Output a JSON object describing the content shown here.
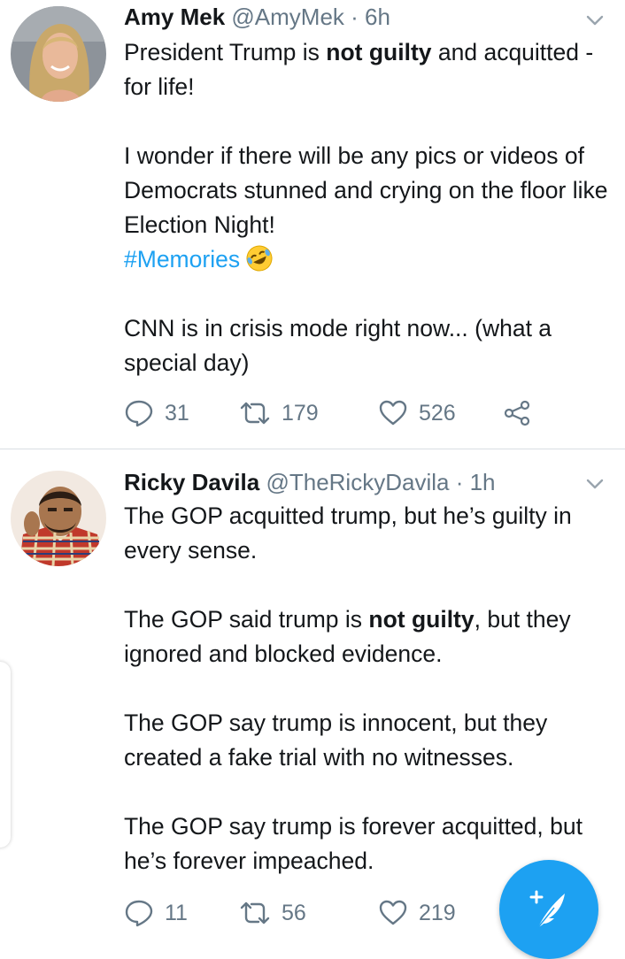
{
  "tweets": [
    {
      "name": "Amy Mek",
      "handle": "@AmyMek",
      "dot": "·",
      "time": "6h",
      "text": {
        "p1_a": "President Trump is ",
        "p1_bold": "not guilty",
        "p1_b": " and acquitted - for life!",
        "p2": "I wonder if there will be any pics or videos of Democrats stunned and crying on the floor like Election Night!",
        "hashtag": "#Memories",
        "p3": "CNN is in crisis mode right now... (what a special day)"
      },
      "replies": "31",
      "retweets": "179",
      "likes": "526"
    },
    {
      "name": "Ricky Davila",
      "handle": "@TheRickyDavila",
      "dot": "·",
      "time": "1h",
      "text": {
        "p1": "The GOP acquitted trump, but he’s guilty in every sense.",
        "p2_a": "The GOP said trump is ",
        "p2_bold": "not guilty",
        "p2_b": ", but they ignored and blocked evidence.",
        "p3": "The GOP say trump is innocent, but they created a fake trial with no witnesses.",
        "p4": "The GOP say trump is forever acquitted, but he’s forever impeached."
      },
      "replies": "11",
      "retweets": "56",
      "likes": "219"
    }
  ],
  "icons": {
    "reply": "reply-icon",
    "retweet": "retweet-icon",
    "like": "heart-icon",
    "share": "share-icon",
    "caret": "chevron-down-icon",
    "compose": "compose-tweet-icon",
    "emoji": "rolling-on-the-floor-laughing-emoji"
  },
  "colors": {
    "accent": "#1da1f2",
    "text": "#14171a",
    "secondary": "#657786",
    "divider": "#d8dee3"
  }
}
